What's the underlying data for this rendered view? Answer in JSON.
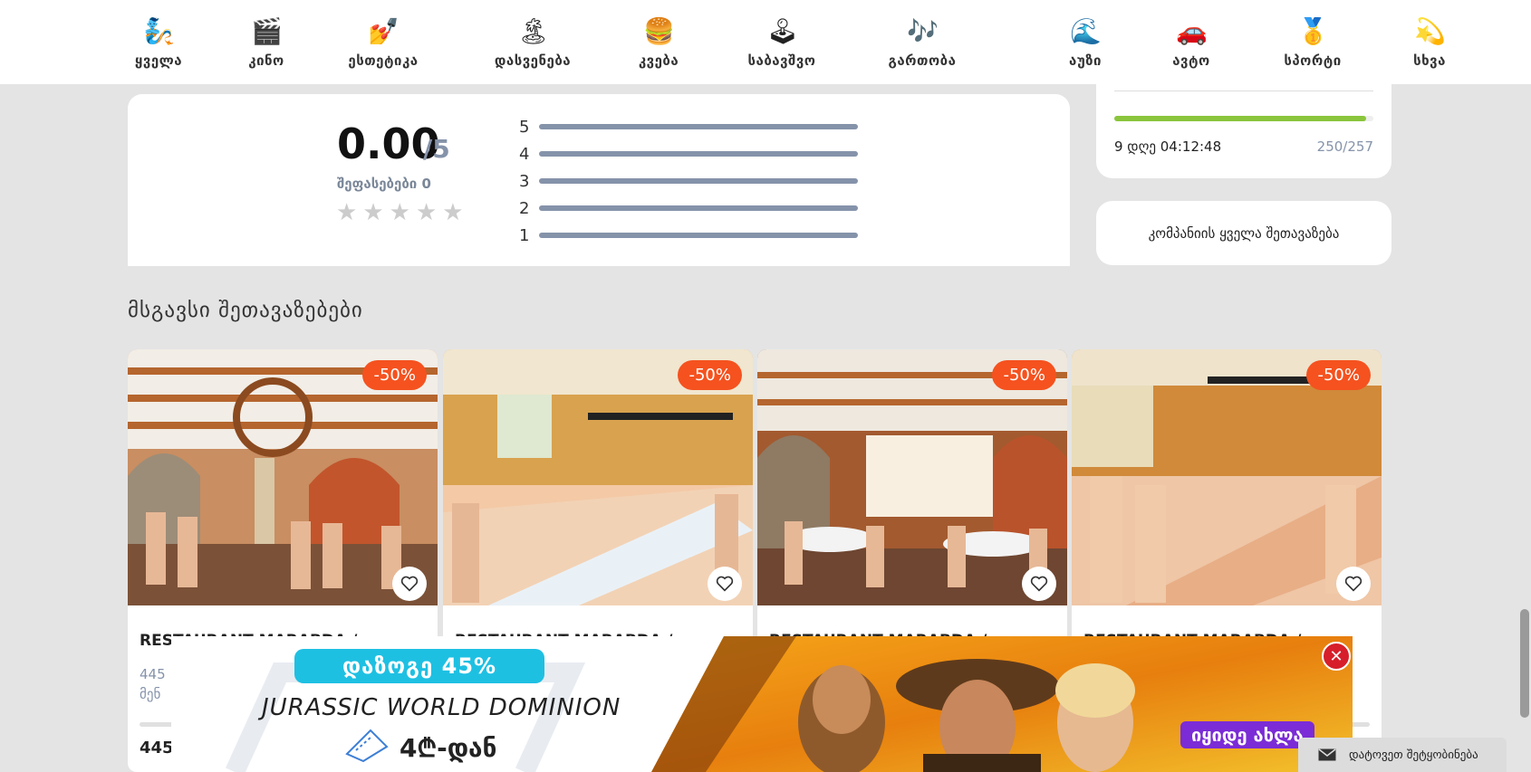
{
  "nav": {
    "categories": [
      {
        "label": "ყველა",
        "icon": "genie-icon",
        "glyph": "🧞"
      },
      {
        "label": "კინო",
        "icon": "clapperboard-icon",
        "glyph": "🎬"
      },
      {
        "label": "ესთეტიკა",
        "icon": "nail-polish-icon",
        "glyph": "💅"
      },
      {
        "label": "დასვენება",
        "icon": "palm-island-icon",
        "glyph": "🏝"
      },
      {
        "label": "კვება",
        "icon": "burger-icon",
        "glyph": "🍔"
      },
      {
        "label": "საბავშვო",
        "icon": "joystick-icon",
        "glyph": "🕹"
      },
      {
        "label": "გართობა",
        "icon": "music-notes-icon",
        "glyph": "🎶"
      },
      {
        "label": "აუზი",
        "icon": "wave-icon",
        "glyph": "🌊"
      },
      {
        "label": "ავტო",
        "icon": "car-icon",
        "glyph": "🚗"
      },
      {
        "label": "სპორტი",
        "icon": "medal-icon",
        "glyph": "🥇"
      },
      {
        "label": "სხვა",
        "icon": "dizzy-star-icon",
        "glyph": "💫"
      }
    ]
  },
  "rating": {
    "score": "0.00",
    "max": "/5",
    "count_label": "შეფასებები 0",
    "stars_filled": 0,
    "stars_total": 5,
    "bars": [
      "5",
      "4",
      "3",
      "2",
      "1"
    ]
  },
  "sidebar": {
    "progress_fraction": 0.973,
    "timer": "9 დღე 04:12:48",
    "count": "250/257",
    "all_offers_label": "კომპანიის ყველა შეთავაზება"
  },
  "similar": {
    "title": "მსგავსი შეთავაზებები",
    "offers": [
      {
        "discount": "-50%",
        "title": "RESTAURANT MARABDA /",
        "desc_line1": "445",
        "desc_line2": "მენ",
        "price": "445"
      },
      {
        "discount": "-50%",
        "title": "RESTAURANT MARABDA /",
        "desc_line1": "",
        "desc_line2": "",
        "price": ""
      },
      {
        "discount": "-50%",
        "title": "RESTAURANT MARABDA /",
        "desc_line1": "",
        "desc_line2": "",
        "price": ""
      },
      {
        "discount": "-50%",
        "title": "RESTAURANT MARABDA /",
        "desc_line1": "",
        "desc_line2": "",
        "price": ""
      }
    ]
  },
  "ad": {
    "tag": "დაზოგე 45%",
    "movie": "JURASSIC WORLD DOMINION",
    "price": "4₾-დან",
    "buy_label": "იყიდე ახლა"
  },
  "message": {
    "label": "დატოვეთ შეტყობინება"
  },
  "colors": {
    "discount": "#f5521f",
    "progress": "#8ac53c",
    "muted": "#8593aa",
    "ad_tag": "#1ec0e2",
    "ad_buy": "#7b2cd6"
  }
}
